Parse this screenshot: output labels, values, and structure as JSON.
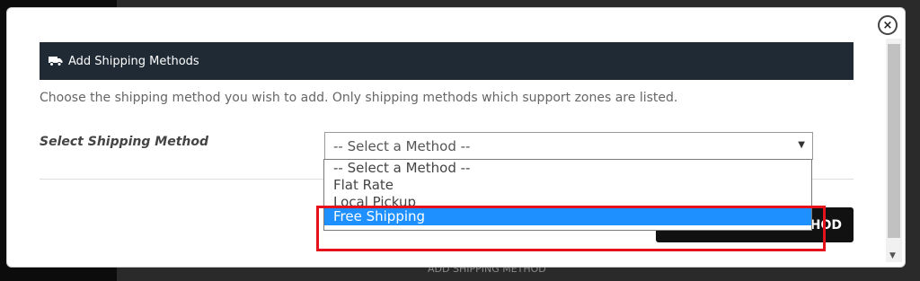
{
  "modal": {
    "close_glyph": "×",
    "header_title": "Add Shipping Methods",
    "description": "Choose the shipping method you wish to add. Only shipping methods which support zones are listed.",
    "field_label": "Select Shipping Method",
    "select_value": "-- Select a Method --",
    "add_button_label": "HOD"
  },
  "dropdown": {
    "options": [
      {
        "label": "-- Select a Method --"
      },
      {
        "label": "Flat Rate"
      },
      {
        "label": "Local Pickup"
      },
      {
        "label": "Free Shipping"
      }
    ],
    "selected_index": 3
  },
  "icons": {
    "header": "truck-icon",
    "close": "close-icon",
    "select": "chevron-down-icon"
  },
  "colors": {
    "header_bg": "#1f2a35",
    "selected_option": "#1e90ff",
    "highlight": "#e3121b",
    "button_bg": "#111111"
  },
  "background": {
    "under_text": "ADD SHIPPING METHOD"
  }
}
